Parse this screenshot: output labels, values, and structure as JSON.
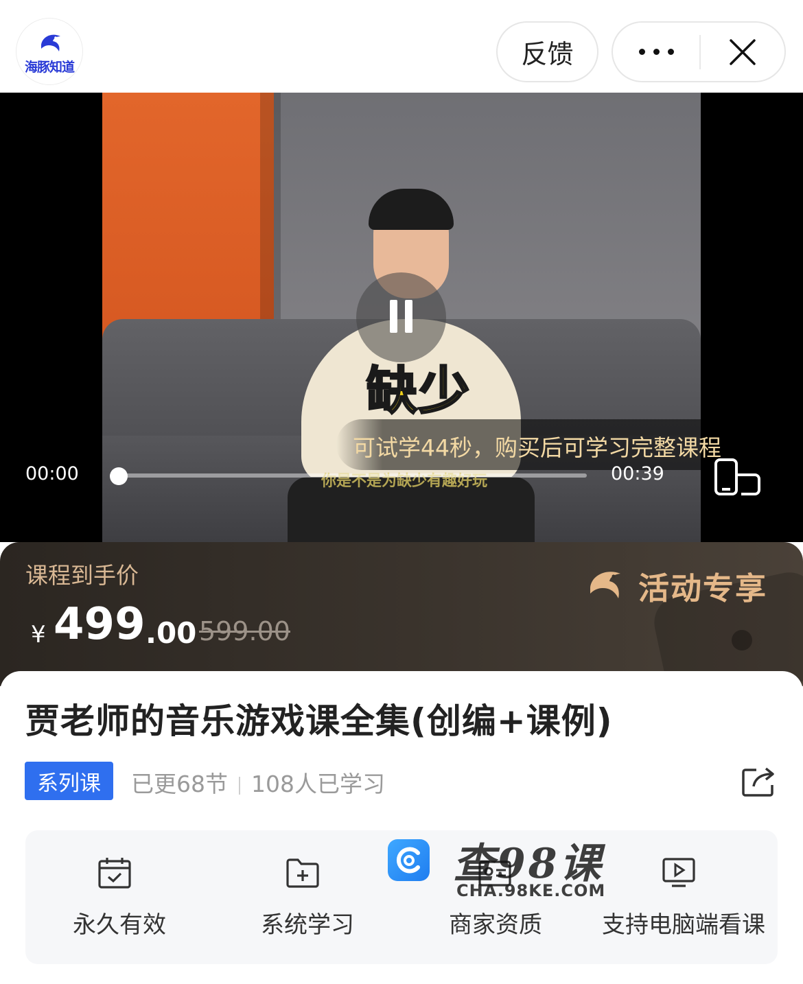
{
  "header": {
    "logo_text": "海豚知道",
    "feedback_label": "反馈",
    "more_icon": "more-dots-icon",
    "close_icon": "close-icon"
  },
  "video": {
    "overlay_word": "缺少",
    "subtitle": "你是不是为缺少有趣好玩",
    "trial_tip": "可试学44秒，购买后可学习完整课程",
    "current_time": "00:00",
    "total_time": "00:39",
    "progress": 0.0,
    "state": "playing"
  },
  "price": {
    "label": "课程到手价",
    "currency": "¥",
    "integer": "499",
    "decimal": ".00",
    "original": "599.00",
    "promo_text": "活动专享"
  },
  "course": {
    "title": "贾老师的音乐游戏课全集(创编+课例)",
    "badge": "系列课",
    "updated": "已更68节",
    "learners": "108人已学习"
  },
  "features": [
    {
      "label": "永久有效",
      "icon": "calendar-check-icon"
    },
    {
      "label": "系统学习",
      "icon": "folder-add-icon"
    },
    {
      "label": "商家资质",
      "icon": "id-card-icon"
    },
    {
      "label": "支持电脑端看课",
      "icon": "monitor-play-icon"
    }
  ],
  "watermark": {
    "text": "查98课",
    "url": "CHA.98KE.COM"
  },
  "colors": {
    "accent_blue": "#2f6fef",
    "price_banner": "#3b342d",
    "promo_gold": "#e5b889",
    "trial_tip": "#f3d9a4"
  }
}
